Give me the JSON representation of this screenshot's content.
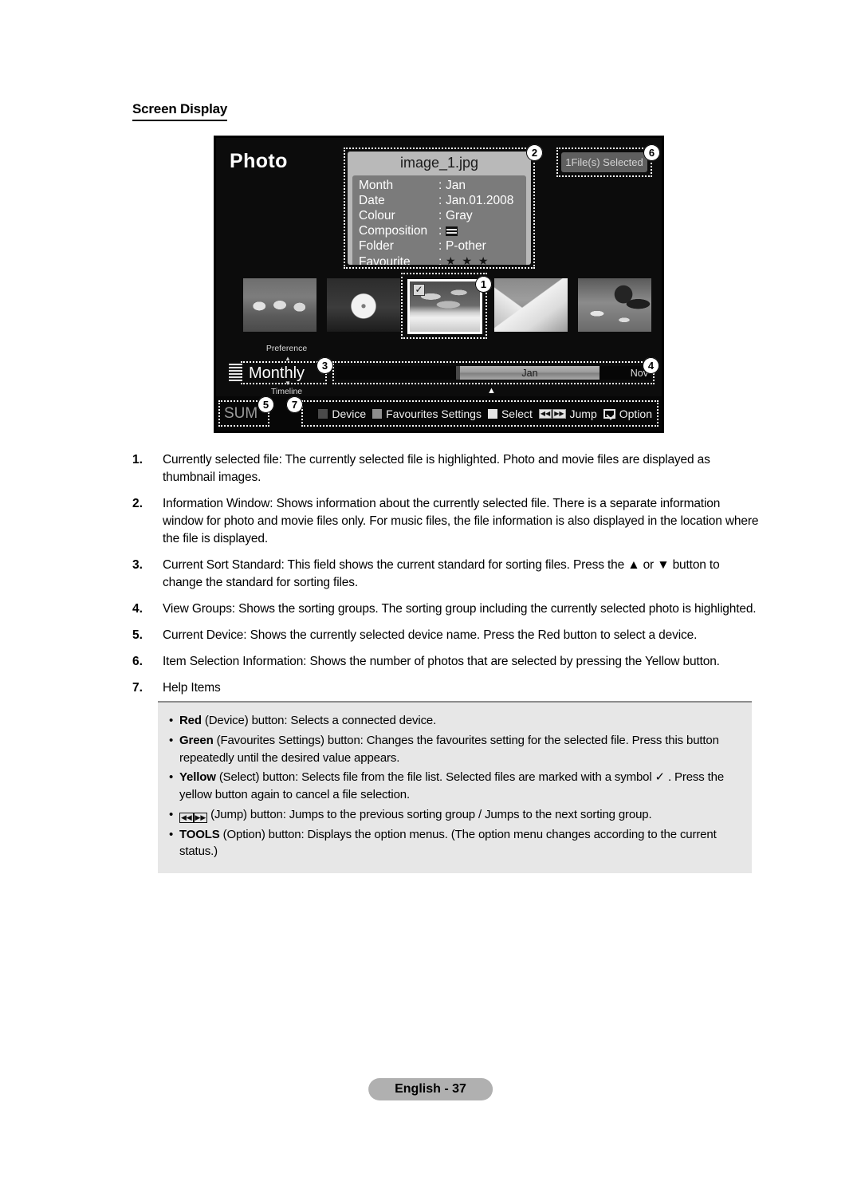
{
  "section": {
    "heading": "Screen Display"
  },
  "tv": {
    "title": "Photo",
    "info": {
      "filename": "image_1.jpg",
      "rows": [
        {
          "label": "Month",
          "colon": ":",
          "value": "Jan"
        },
        {
          "label": "Date",
          "colon": ":",
          "value": "Jan.01.2008"
        },
        {
          "label": "Colour",
          "colon": ":",
          "value": "Gray"
        },
        {
          "label": "Composition",
          "colon": ":",
          "value": ""
        },
        {
          "label": "Folder",
          "colon": ":",
          "value": "P-other"
        },
        {
          "label": "Favourite",
          "colon": ":",
          "value": ""
        }
      ],
      "favourite_stars": "★ ★ ★"
    },
    "selection_badge": "1File(s) Selected",
    "sort": {
      "above_label": "Preference",
      "below_label": "Timeline",
      "value": "Monthly",
      "caret_up": "▲",
      "caret_down": "▼"
    },
    "groups": {
      "active_label": "Jan",
      "last_label": "Nov",
      "marker": "▲"
    },
    "device": {
      "name": "SUM"
    },
    "help_bar": [
      {
        "icon": "red-square",
        "swatch": "#4a4a4a",
        "label": "Device"
      },
      {
        "icon": "green-square",
        "swatch": "#8e8e8e",
        "label": "Favourites Settings"
      },
      {
        "icon": "yellow-square",
        "swatch": "#e6e6e6",
        "label": "Select"
      },
      {
        "icon": "jump-glyphs",
        "glyph_prev": "◀◀",
        "glyph_next": "▶▶",
        "label": "Jump"
      },
      {
        "icon": "tools-glyph",
        "label": "Option"
      }
    ],
    "callouts": [
      "1",
      "2",
      "3",
      "4",
      "5",
      "6",
      "7"
    ]
  },
  "descriptions": [
    {
      "num": "1.",
      "text": "Currently selected file: The currently selected file is highlighted. Photo and movie files are displayed as thumbnail images."
    },
    {
      "num": "2.",
      "text": "Information Window: Shows information about the currently selected file. There is a separate information window for photo and movie files only. For music files, the file information is also displayed in the location where the file is displayed."
    },
    {
      "num": "3.",
      "text": "Current Sort Standard: This field shows the current standard for sorting files. Press the ▲ or ▼ button to change the standard for sorting files."
    },
    {
      "num": "4.",
      "text": "View Groups: Shows the sorting groups. The sorting group including the currently selected photo is highlighted."
    },
    {
      "num": "5.",
      "text": "Current Device: Shows the currently selected device name. Press the Red button to select a device."
    },
    {
      "num": "6.",
      "text": "Item Selection Information: Shows the number of photos that are selected by pressing the Yellow button."
    },
    {
      "num": "7.",
      "text": "Help Items"
    }
  ],
  "help_box": {
    "bullet": "•",
    "items": [
      {
        "bold": "Red",
        "rest": " (Device) button: Selects a connected device."
      },
      {
        "bold": "Green",
        "rest": " (Favourites Settings) button: Changes the favourites setting for the selected file. Press this button repeatedly until the desired value appears."
      },
      {
        "bold": "Yellow",
        "rest": " (Select) button: Selects file from the file list. Selected files are marked with a symbol ✓ . Press the yellow button again to cancel a file selection."
      },
      {
        "bold": "",
        "rest": " (Jump) button: Jumps to the previous sorting group / Jumps to the next sorting group.",
        "glyph_prev": "◀◀",
        "glyph_next": "▶▶"
      },
      {
        "bold": "TOOLS",
        "rest": " (Option) button: Displays the option menus. (The option menu changes according to the current status.)"
      }
    ]
  },
  "footer": {
    "page_label": "English - 37"
  }
}
